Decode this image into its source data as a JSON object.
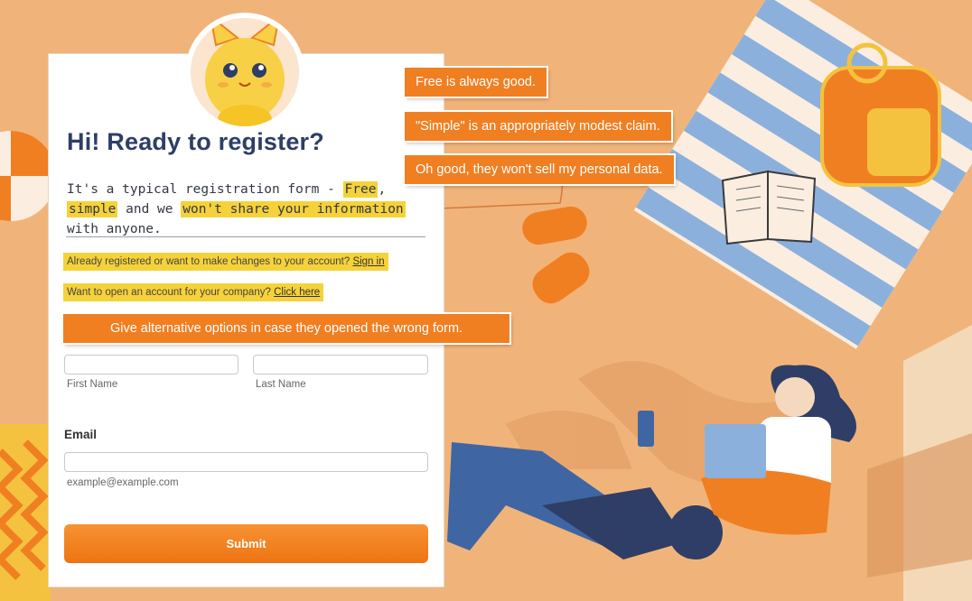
{
  "form": {
    "title": "Hi! Ready to register?",
    "intro": {
      "text_before": "It's a typical registration form - ",
      "free": "Free",
      "comma": ", ",
      "simple": "simple",
      "mid": " and we ",
      "no_share": "won't share your information",
      "text_after": " with anyone."
    },
    "already_registered": {
      "text": "Already registered or want to make changes to your account? ",
      "link": "Sign in"
    },
    "company_account": {
      "text": "Want to open an account for your company? ",
      "link": "Click here"
    },
    "first_name": {
      "value": "",
      "sublabel": "First Name"
    },
    "last_name": {
      "value": "",
      "sublabel": "Last Name"
    },
    "email": {
      "label": "Email",
      "value": "",
      "sublabel": "example@example.com"
    },
    "submit_label": "Submit"
  },
  "callouts": {
    "free": "Free is always good.",
    "simple": "\"Simple\" is an appropriately modest claim.",
    "data": "Oh good, they won't sell my personal data.",
    "alternatives": "Give alternative options in case they opened the wrong form."
  },
  "colors": {
    "accent": "#f07f22",
    "highlight": "#f6d23a",
    "background": "#f0b47a",
    "title": "#2e3e66"
  },
  "icons": [
    "cat-mascot-icon",
    "beach-ball-icon",
    "backpack-icon",
    "book-icon",
    "sandal-icon",
    "phone-icon",
    "laptop-icon"
  ]
}
